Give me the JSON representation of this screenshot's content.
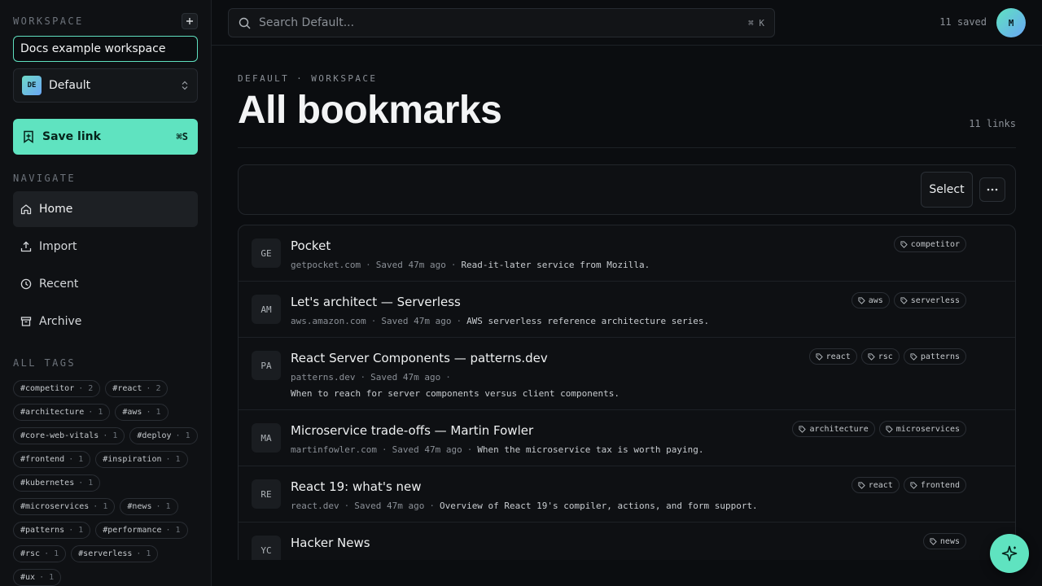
{
  "sidebar": {
    "workspace_label": "WORKSPACE",
    "add_icon": "plus-icon",
    "workspace_input": "Docs example workspace",
    "selected_workspace": {
      "initials": "DE",
      "name": "Default"
    },
    "save_button": {
      "label": "Save link",
      "shortcut": "⌘S"
    },
    "navigate_label": "NAVIGATE",
    "nav": [
      {
        "label": "Home",
        "icon": "home-icon",
        "active": true
      },
      {
        "label": "Import",
        "icon": "upload-icon"
      },
      {
        "label": "Recent",
        "icon": "clock-icon"
      },
      {
        "label": "Archive",
        "icon": "archive-icon"
      }
    ],
    "tags_label": "ALL TAGS",
    "tags": [
      {
        "name": "#competitor",
        "count": "· 2"
      },
      {
        "name": "#react",
        "count": "· 2"
      },
      {
        "name": "#architecture",
        "count": "· 1"
      },
      {
        "name": "#aws",
        "count": "· 1"
      },
      {
        "name": "#core-web-vitals",
        "count": "· 1"
      },
      {
        "name": "#deploy",
        "count": "· 1"
      },
      {
        "name": "#frontend",
        "count": "· 1"
      },
      {
        "name": "#inspiration",
        "count": "· 1"
      },
      {
        "name": "#kubernetes",
        "count": "· 1"
      },
      {
        "name": "#microservices",
        "count": "· 1"
      },
      {
        "name": "#news",
        "count": "· 1"
      },
      {
        "name": "#patterns",
        "count": "· 1"
      },
      {
        "name": "#performance",
        "count": "· 1"
      },
      {
        "name": "#rsc",
        "count": "· 1"
      },
      {
        "name": "#serverless",
        "count": "· 1"
      },
      {
        "name": "#ux",
        "count": "· 1"
      }
    ]
  },
  "topbar": {
    "search_placeholder": "Search Default...",
    "search_shortcut": "⌘ K",
    "saved_count": "11 saved",
    "avatar_initial": "M"
  },
  "main": {
    "crumb": "DEFAULT · WORKSPACE",
    "title": "All bookmarks",
    "links_count": "11 links",
    "select_label": "Select",
    "more_label": "···"
  },
  "bookmarks": [
    {
      "fav": "GE",
      "title": "Pocket",
      "domain": "getpocket.com",
      "saved": "Saved 47m ago",
      "desc": "Read-it-later service from Mozilla.",
      "tags": [
        "competitor"
      ]
    },
    {
      "fav": "AM",
      "title": "Let's architect — Serverless",
      "domain": "aws.amazon.com",
      "saved": "Saved 47m ago",
      "desc": "AWS serverless reference architecture series.",
      "tags": [
        "aws",
        "serverless"
      ]
    },
    {
      "fav": "PA",
      "title": "React Server Components — patterns.dev",
      "domain": "patterns.dev",
      "saved": "Saved 47m ago",
      "desc": "When to reach for server components versus client components.",
      "tags": [
        "react",
        "rsc",
        "patterns"
      ],
      "wrap": true
    },
    {
      "fav": "MA",
      "title": "Microservice trade-offs — Martin Fowler",
      "domain": "martinfowler.com",
      "saved": "Saved 47m ago",
      "desc": "When the microservice tax is worth paying.",
      "tags": [
        "architecture",
        "microservices"
      ]
    },
    {
      "fav": "RE",
      "title": "React 19: what's new",
      "domain": "react.dev",
      "saved": "Saved 47m ago",
      "desc": "Overview of React 19's compiler, actions, and form support.",
      "tags": [
        "react",
        "frontend"
      ]
    },
    {
      "fav": "YC",
      "title": "Hacker News",
      "domain": "",
      "saved": "",
      "desc": "",
      "tags": [
        "news"
      ]
    }
  ],
  "fab_icon": "sparkle-icon",
  "colors": {
    "accent": "#5fe3c0",
    "background": "#0b0d10",
    "sidebar": "#0f1114"
  }
}
